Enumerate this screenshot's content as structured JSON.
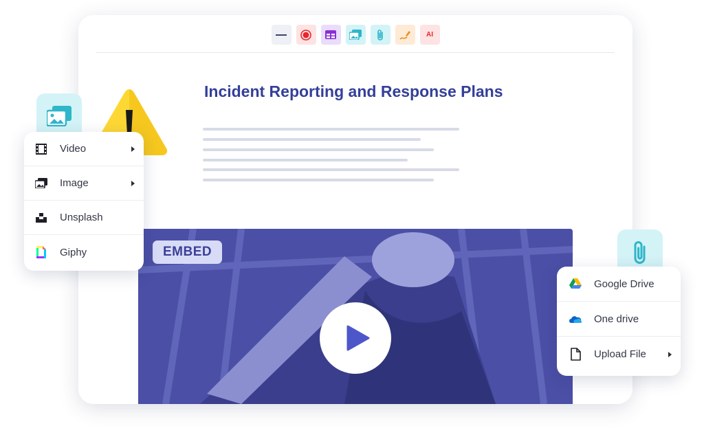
{
  "toolbar": {
    "buttons": [
      {
        "name": "divider-line-icon",
        "bg": "#eef0f6"
      },
      {
        "name": "record-icon",
        "bg": "#fde3e3"
      },
      {
        "name": "table-icon",
        "bg": "#eadcfb"
      },
      {
        "name": "media-icon",
        "bg": "#d3f3f7"
      },
      {
        "name": "attachment-icon",
        "bg": "#d3f3f7"
      },
      {
        "name": "drawing-icon",
        "bg": "#fdebd6"
      },
      {
        "name": "ai-icon",
        "bg": "#fde3e3",
        "text": "AI"
      }
    ]
  },
  "document": {
    "title": "Incident Reporting and Response Plans",
    "title_color": "#343f9a"
  },
  "video": {
    "badge": "EMBED",
    "tint_color": "#4b4fa6"
  },
  "media_menu": {
    "items": [
      {
        "label": "Video",
        "icon": "film-icon",
        "submenu": true
      },
      {
        "label": "Image",
        "icon": "image-icon",
        "submenu": true
      },
      {
        "label": "Unsplash",
        "icon": "unsplash-icon",
        "submenu": false
      },
      {
        "label": "Giphy",
        "icon": "giphy-icon",
        "submenu": false
      }
    ]
  },
  "attach_menu": {
    "items": [
      {
        "label": "Google Drive",
        "icon": "google-drive-icon",
        "submenu": false
      },
      {
        "label": "One drive",
        "icon": "onedrive-icon",
        "submenu": false
      },
      {
        "label": "Upload File",
        "icon": "file-icon",
        "submenu": true
      }
    ]
  },
  "colors": {
    "accent_teal": "#2fb6c9",
    "brand_blue": "#343f9a",
    "play_blue": "#4e57c9"
  }
}
